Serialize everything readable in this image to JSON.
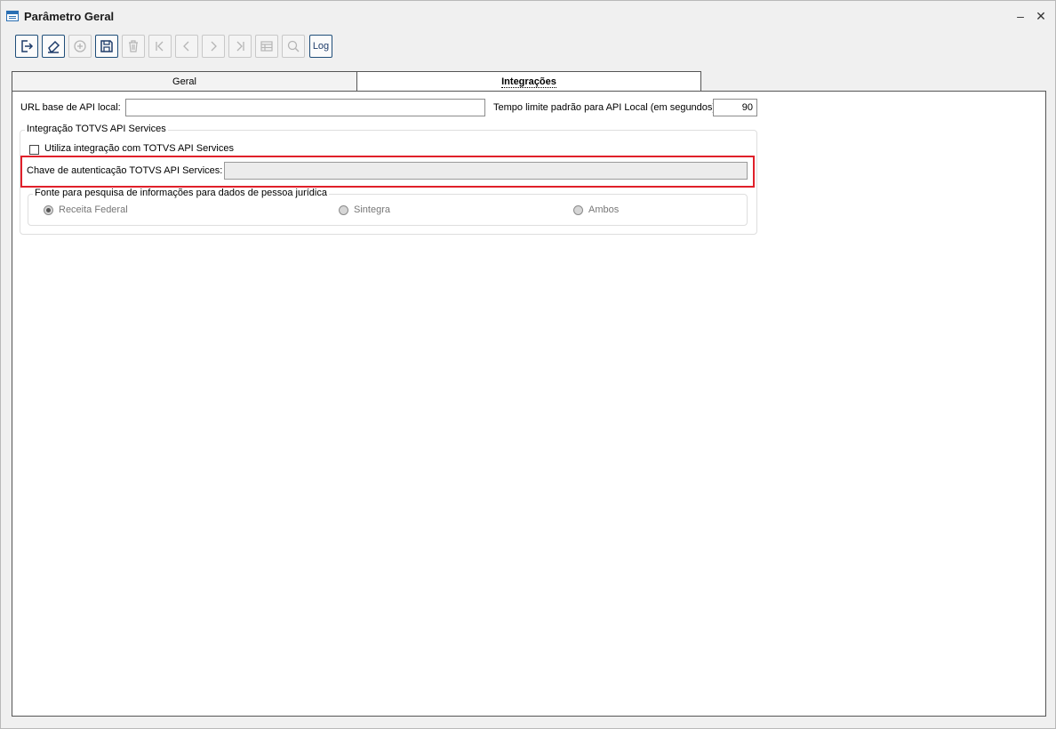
{
  "window": {
    "title": "Parâmetro Geral",
    "minimize_label": "–",
    "close_label": "✕"
  },
  "toolbar": {
    "buttons": [
      {
        "name": "exit-button",
        "icon": "exit-icon"
      },
      {
        "name": "clear-button",
        "icon": "eraser-icon"
      },
      {
        "name": "add-button",
        "icon": "plus-circle-icon"
      },
      {
        "name": "save-button",
        "icon": "save-icon"
      },
      {
        "name": "delete-button",
        "icon": "trash-icon"
      },
      {
        "name": "first-button",
        "icon": "first-icon"
      },
      {
        "name": "prev-button",
        "icon": "prev-icon"
      },
      {
        "name": "next-button",
        "icon": "next-icon"
      },
      {
        "name": "last-button",
        "icon": "last-icon"
      },
      {
        "name": "grid-button",
        "icon": "table-icon"
      },
      {
        "name": "search-button",
        "icon": "search-icon"
      }
    ],
    "log_label": "Log"
  },
  "tabs": [
    {
      "label": "Geral",
      "selected": false
    },
    {
      "label": "Integrações",
      "selected": true
    }
  ],
  "form": {
    "url_label": "URL base de API local:",
    "url_value": "",
    "timeout_label": "Tempo limite padrão para API Local (em segundos):",
    "timeout_value": "90",
    "group_title": "Integração TOTVS API Services",
    "checkbox_label": "Utiliza integração com TOTVS API Services",
    "checkbox_checked": false,
    "key_label": "Chave de autenticação TOTVS API Services:",
    "key_value": "",
    "source_title": "Fonte para pesquisa de informações para dados de pessoa jurídica",
    "radios": [
      {
        "label": "Receita Federal",
        "checked": true
      },
      {
        "label": "Sintegra",
        "checked": false
      },
      {
        "label": "Ambos",
        "checked": false
      }
    ]
  },
  "colors": {
    "highlight": "#e0202a",
    "accent": "#1f4e79"
  }
}
